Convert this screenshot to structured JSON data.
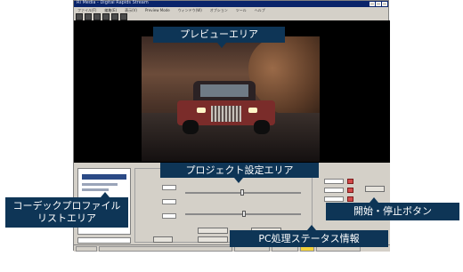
{
  "window": {
    "title": "Ri Media - Digital Rapids Stream",
    "menu": [
      "ファイル(F)",
      "編集(E)",
      "表示(V)",
      "Preview Mode",
      "ウィンドウ(W)",
      "オプション",
      "ツール",
      "ヘルプ"
    ]
  },
  "callouts": {
    "preview": "プレビューエリア",
    "project": "プロジェクト設定エリア",
    "codec_line1": "コーデックプロファイル",
    "codec_line2": "リストエリア",
    "startstop": "開始・停止ボタン",
    "status": "PC処理ステータス情報"
  },
  "colors": {
    "callout_bg": "#0e3556",
    "titlebar": "#0a246a",
    "status_highlight": "#f3d23b"
  }
}
